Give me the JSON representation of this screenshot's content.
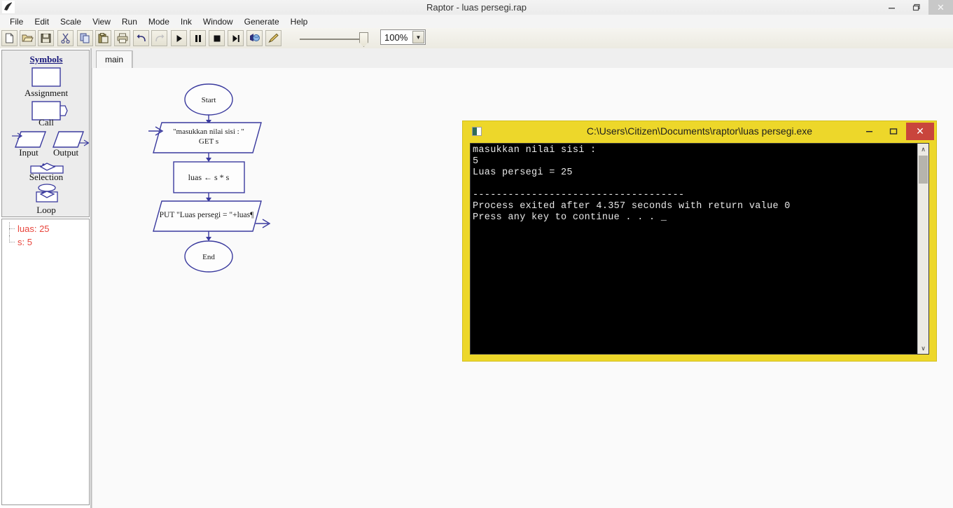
{
  "window": {
    "title": "Raptor - luas persegi.rap",
    "app_icon": "raptor-icon",
    "minimize": "–",
    "maximize": "❐",
    "close": "✕"
  },
  "menubar": {
    "items": [
      {
        "label": "File"
      },
      {
        "label": "Edit"
      },
      {
        "label": "Scale"
      },
      {
        "label": "View"
      },
      {
        "label": "Run"
      },
      {
        "label": "Mode"
      },
      {
        "label": "Ink"
      },
      {
        "label": "Window"
      },
      {
        "label": "Generate"
      },
      {
        "label": "Help"
      }
    ]
  },
  "toolbar": {
    "buttons": [
      {
        "name": "new-icon",
        "title": "New"
      },
      {
        "name": "open-icon",
        "title": "Open"
      },
      {
        "name": "save-icon",
        "title": "Save"
      },
      {
        "name": "cut-icon",
        "title": "Cut"
      },
      {
        "name": "copy-icon",
        "title": "Copy"
      },
      {
        "name": "paste-icon",
        "title": "Paste"
      },
      {
        "name": "print-icon",
        "title": "Print"
      },
      {
        "name": "undo-icon",
        "title": "Undo"
      },
      {
        "name": "redo-icon",
        "title": "Redo"
      },
      {
        "name": "play-icon",
        "title": "Run"
      },
      {
        "name": "pause-icon",
        "title": "Pause"
      },
      {
        "name": "stop-icon",
        "title": "Stop"
      },
      {
        "name": "step-icon",
        "title": "Step"
      },
      {
        "name": "globe-icon",
        "title": "View Intermediate Code"
      },
      {
        "name": "pen-icon",
        "title": "Ink"
      }
    ],
    "zoom_value": "100%",
    "zoom_dropdown_arrow": "▼"
  },
  "sidebar": {
    "title": "Symbols",
    "symbols": [
      {
        "label": "Assignment",
        "shape": "rectangle"
      },
      {
        "label": "Call",
        "shape": "call"
      },
      {
        "label": "Input",
        "shape": "parallelogram-in"
      },
      {
        "label": "Output",
        "shape": "parallelogram-out"
      },
      {
        "label": "Selection",
        "shape": "diamond"
      },
      {
        "label": "Loop",
        "shape": "loop"
      }
    ],
    "watch": {
      "variables": [
        {
          "text": "luas: 25"
        },
        {
          "text": "s: 5"
        }
      ]
    }
  },
  "tabs": {
    "items": [
      {
        "label": "main"
      }
    ]
  },
  "flowchart": {
    "nodes": [
      {
        "type": "terminal",
        "label": "Start"
      },
      {
        "type": "input",
        "line1": "\"masukkan nilai sisi : \"",
        "line2": "GET s"
      },
      {
        "type": "assignment",
        "label": "luas ← s * s"
      },
      {
        "type": "output",
        "label": "PUT \"Luas persegi = \"+luas¶"
      },
      {
        "type": "terminal",
        "label": "End"
      }
    ],
    "line_color": "#3a3a9e"
  },
  "console": {
    "title": "C:\\Users\\Citizen\\Documents\\raptor\\luas persegi.exe",
    "icon": "console-icon",
    "minimize": "–",
    "maximize": "❐",
    "close": "✕",
    "output": "masukkan nilai sisi :\n5\nLuas persegi = 25\n\n------------------------------------\nProcess exited after 4.357 seconds with return value 0\nPress any key to continue . . . _",
    "scroll_up": "∧",
    "scroll_down": "∨"
  },
  "colors": {
    "console_chrome": "#edd72a",
    "console_bg": "#000000",
    "close_red": "#c9453c",
    "flow_line": "#3a3a9e",
    "watch_text": "#e8453c",
    "symbols_title": "#16167a"
  }
}
